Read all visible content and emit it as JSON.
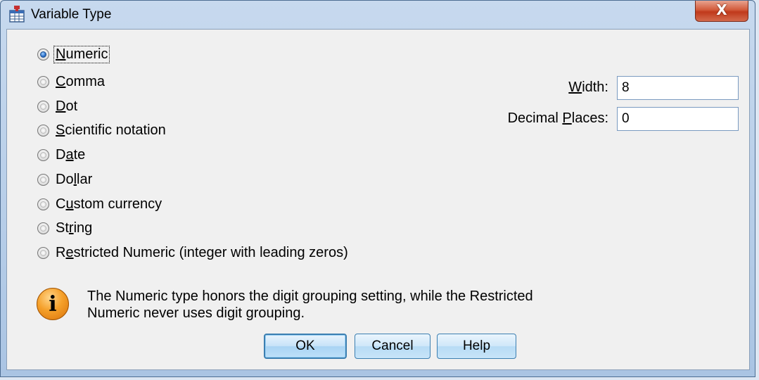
{
  "window": {
    "title": "Variable Type",
    "close_glyph": "X",
    "app_icon": "variable-table-icon"
  },
  "types": [
    {
      "pre": "",
      "mn": "N",
      "post": "umeric",
      "checked": true
    },
    {
      "pre": "",
      "mn": "C",
      "post": "omma",
      "checked": false
    },
    {
      "pre": "",
      "mn": "D",
      "post": "ot",
      "checked": false
    },
    {
      "pre": "",
      "mn": "S",
      "post": "cientific notation",
      "checked": false
    },
    {
      "pre": "D",
      "mn": "a",
      "post": "te",
      "checked": false
    },
    {
      "pre": "Do",
      "mn": "l",
      "post": "lar",
      "checked": false
    },
    {
      "pre": "C",
      "mn": "u",
      "post": "stom currency",
      "checked": false
    },
    {
      "pre": "St",
      "mn": "r",
      "post": "ing",
      "checked": false
    },
    {
      "pre": "R",
      "mn": "e",
      "post": "stricted Numeric (integer with leading zeros)",
      "checked": false
    }
  ],
  "width": {
    "pre": "",
    "mn": "W",
    "post": "idth:",
    "value": "8"
  },
  "decimal": {
    "pre": "Decimal ",
    "mn": "P",
    "post": "laces:",
    "value": "0"
  },
  "info": {
    "icon": "info-icon",
    "glyph": "i",
    "text_line1": "The Numeric type honors the digit grouping setting, while the Restricted",
    "text_line2": "Numeric never uses digit grouping."
  },
  "buttons": {
    "ok": "OK",
    "cancel": "Cancel",
    "help": "Help"
  }
}
